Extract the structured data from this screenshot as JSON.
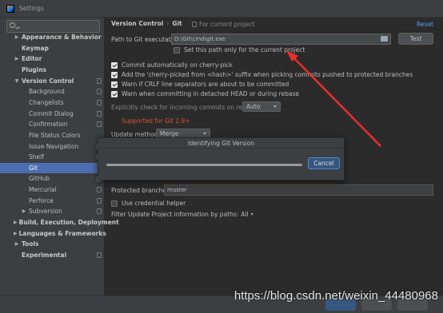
{
  "window": {
    "title": "Settings"
  },
  "sidebar": {
    "items": [
      {
        "label": "Appearance & Behavior",
        "arrow": "▶",
        "bold": true,
        "proj": false
      },
      {
        "label": "Keymap",
        "arrow": "",
        "bold": true,
        "proj": false
      },
      {
        "label": "Editor",
        "arrow": "▶",
        "bold": true,
        "proj": false
      },
      {
        "label": "Plugins",
        "arrow": "",
        "bold": true,
        "proj": false
      },
      {
        "label": "Version Control",
        "arrow": "▼",
        "bold": true,
        "proj": true
      },
      {
        "label": "Background",
        "arrow": "",
        "bold": false,
        "proj": true
      },
      {
        "label": "Changelists",
        "arrow": "",
        "bold": false,
        "proj": true
      },
      {
        "label": "Commit Dialog",
        "arrow": "",
        "bold": false,
        "proj": true
      },
      {
        "label": "Confirmation",
        "arrow": "",
        "bold": false,
        "proj": true
      },
      {
        "label": "File Status Colors",
        "arrow": "",
        "bold": false,
        "proj": false
      },
      {
        "label": "Issue Navigation",
        "arrow": "",
        "bold": false,
        "proj": true
      },
      {
        "label": "Shelf",
        "arrow": "",
        "bold": false,
        "proj": true
      },
      {
        "label": "Git",
        "arrow": "",
        "bold": false,
        "proj": true,
        "selected": true
      },
      {
        "label": "GitHub",
        "arrow": "",
        "bold": false,
        "proj": true
      },
      {
        "label": "Mercurial",
        "arrow": "",
        "bold": false,
        "proj": true
      },
      {
        "label": "Perforce",
        "arrow": "",
        "bold": false,
        "proj": true
      },
      {
        "label": "Subversion",
        "arrow": "▶",
        "bold": false,
        "proj": true
      },
      {
        "label": "Build, Execution, Deployment",
        "arrow": "▶",
        "bold": true,
        "proj": false
      },
      {
        "label": "Languages & Frameworks",
        "arrow": "▶",
        "bold": true,
        "proj": false
      },
      {
        "label": "Tools",
        "arrow": "▶",
        "bold": true,
        "proj": false
      },
      {
        "label": "Experimental",
        "arrow": "",
        "bold": true,
        "proj": true
      }
    ]
  },
  "header": {
    "breadcrumb_1": "Version Control",
    "breadcrumb_sep": "›",
    "breadcrumb_2": "Git",
    "for_current_project": "For current project",
    "reset": "Reset"
  },
  "git": {
    "path_label": "Path to Git executable:",
    "path_value": "D:\\Git\\cmd\\git.exe",
    "test_button": "Test",
    "set_path_only": "Set this path only for the current project",
    "commit_cherry_pick": "Commit automatically on cherry-pick",
    "add_cherry_suffix": "Add the 'cherry-picked from <hash>' suffix when picking commits pushed to protected branches",
    "warn_crlf": "Warn if CRLF line separators are about to be committed",
    "warn_detached": "Warn when committing in detached HEAD or during rebase",
    "explicit_check_label": "Explicitly check for incoming commits on remotes:",
    "explicit_check_value": "Auto",
    "supported_note": "Supported for Git 2.9+",
    "update_method_label": "Update method:",
    "update_method_value": "Merge",
    "protected_branches_label": "Protected branches:",
    "protected_branches_value": "master",
    "use_credential_helper": "Use credential helper",
    "filter_update_label": "Filter Update Project information by paths:",
    "filter_update_value": "All"
  },
  "dialog": {
    "title": "Identifying Git Version",
    "cancel": "Cancel"
  },
  "footer": {
    "help": "?",
    "watermark": "https://blog.csdn.net/weixin_44480968"
  },
  "colors": {
    "accent": "#4b6eaf",
    "link": "#589df6",
    "warning": "#d8532b",
    "annotation_arrow": "#e8302a"
  }
}
